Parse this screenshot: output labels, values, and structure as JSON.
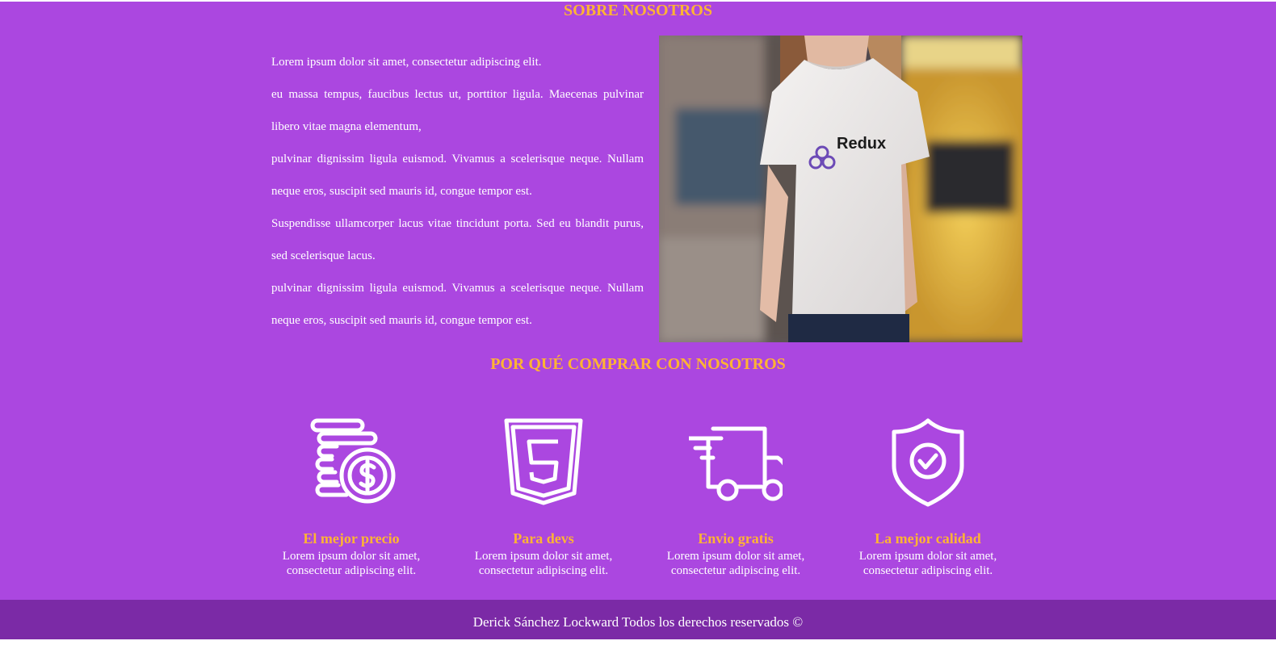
{
  "about": {
    "title": "SOBRE NOSOTROS",
    "paragraphs": [
      "Lorem ipsum dolor sit amet, consectetur adipiscing elit.",
      "eu massa tempus, faucibus lectus ut, porttitor ligula. Maecenas pulvinar libero vitae magna elementum,",
      "pulvinar dignissim ligula euismod. Vivamus a scelerisque neque. Nullam neque eros, suscipit sed mauris id, congue tempor est.",
      "Suspendisse ullamcorper lacus vitae tincidunt porta. Sed eu blandit purus, sed scelerisque lacus.",
      "pulvinar dignissim ligula euismod. Vivamus a scelerisque neque. Nullam neque eros, suscipit sed mauris id, congue tempor est."
    ],
    "image": {
      "shirt_brand": "Redux"
    }
  },
  "why": {
    "title": "POR QUÉ COMPRAR CON NOSOTROS",
    "features": [
      {
        "icon": "coins-dollar-icon",
        "title": "El mejor precio",
        "text": "Lorem ipsum dolor sit amet, consectetur adipiscing elit."
      },
      {
        "icon": "html5-icon",
        "title": "Para devs",
        "text": "Lorem ipsum dolor sit amet, consectetur adipiscing elit."
      },
      {
        "icon": "delivery-truck-icon",
        "title": "Envio gratis",
        "text": "Lorem ipsum dolor sit amet, consectetur adipiscing elit."
      },
      {
        "icon": "shield-check-icon",
        "title": "La mejor calidad",
        "text": "Lorem ipsum dolor sit amet, consectetur adipiscing elit."
      }
    ]
  },
  "footer": {
    "text": "Derick Sánchez Lockward Todos los derechos reservados ©"
  },
  "colors": {
    "background": "#ab47e0",
    "footer_background": "#7b2aa6",
    "accent": "#ffb433",
    "text": "#ffffff"
  }
}
